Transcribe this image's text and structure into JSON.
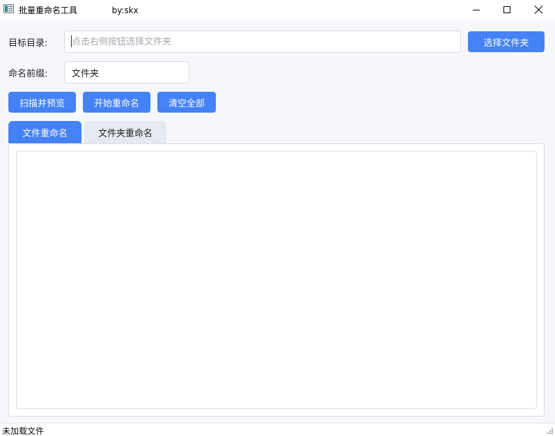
{
  "window": {
    "title": "批量重命名工具             by:skx",
    "minimize_icon": "minimize-icon",
    "maximize_icon": "maximize-icon",
    "close_icon": "close-icon"
  },
  "form": {
    "dir_label": "目标目录:",
    "dir_placeholder": "点击右侧按钮选择文件夹",
    "dir_value": "",
    "choose_button": "选择文件夹",
    "prefix_label": "命名前缀:",
    "prefix_value": "文件夹"
  },
  "actions": {
    "scan": "扫描并预览",
    "start": "开始重命名",
    "clear": "清空全部"
  },
  "tabs": [
    {
      "label": "文件重命名",
      "active": true
    },
    {
      "label": "文件夹重命名",
      "active": false
    }
  ],
  "status": {
    "text": "未加载文件"
  },
  "colors": {
    "accent": "#4581f7",
    "background": "#f5f7fb"
  }
}
